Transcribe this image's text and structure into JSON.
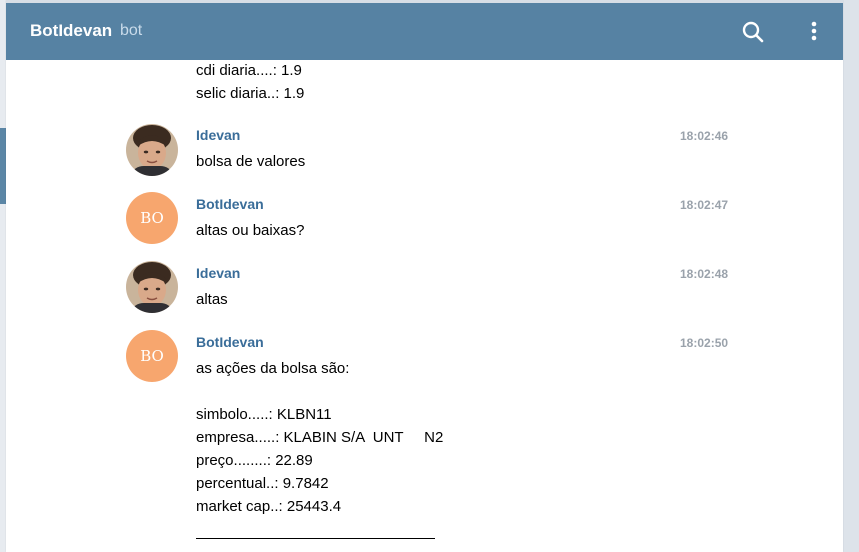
{
  "header": {
    "title": "BotIdevan",
    "subtitle": "bot",
    "search_icon": "search-icon",
    "more_icon": "more-vertical-icon"
  },
  "colors": {
    "header_bg": "#5682a3",
    "sender_name": "#3a6d99",
    "bot_avatar": "#f7a66e",
    "timestamp": "#9aa2ab"
  },
  "previous_message": {
    "lines": [
      "cdi diaria....: 1.9",
      "selic diaria..: 1.9"
    ]
  },
  "messages": [
    {
      "sender": "Idevan",
      "time": "18:02:46",
      "avatar": "photo",
      "lines": [
        "bolsa de valores"
      ]
    },
    {
      "sender": "BotIdevan",
      "time": "18:02:47",
      "avatar": "BO",
      "lines": [
        "altas ou baixas?"
      ]
    },
    {
      "sender": "Idevan",
      "time": "18:02:48",
      "avatar": "photo",
      "lines": [
        "altas"
      ]
    },
    {
      "sender": "BotIdevan",
      "time": "18:02:50",
      "avatar": "BO",
      "lines": [
        "as ações da bolsa são:",
        "",
        "simbolo.....: KLBN11",
        "empresa.....: KLABIN S/A  UNT     N2",
        "preço........: 22.89",
        "percentual..: 9.7842",
        "market cap..: 25443.4"
      ]
    }
  ]
}
